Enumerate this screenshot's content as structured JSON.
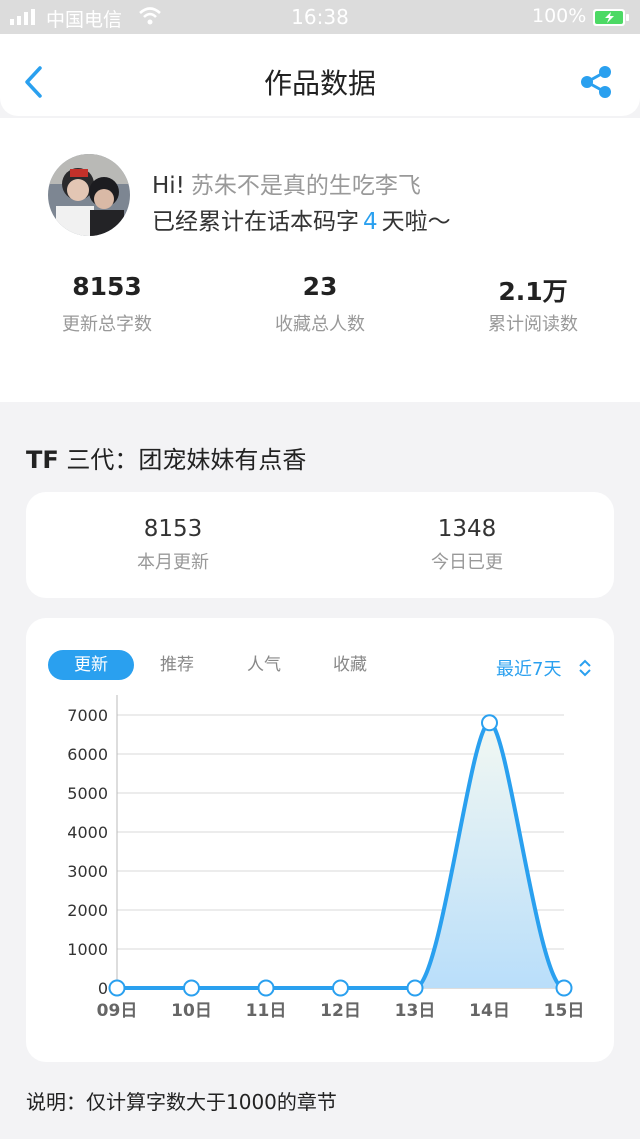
{
  "status_bar": {
    "carrier": "中国电信",
    "time": "16:38",
    "battery": "100%"
  },
  "nav": {
    "title": "作品数据",
    "icons": {
      "back": "back-chevron-icon",
      "share": "share-icon"
    }
  },
  "profile": {
    "greeting": "Hi!",
    "username": "苏朱不是真的生吃李飞",
    "line_prefix": "已经累计在话本码字",
    "days": "4",
    "line_suffix": "天啦～",
    "stats": [
      {
        "value": "8153",
        "label": "更新总字数"
      },
      {
        "value": "23",
        "label": "收藏总人数"
      },
      {
        "value": "2.1万",
        "label": "累计阅读数"
      }
    ]
  },
  "book": {
    "title_prefix": "TF",
    "title_rest": " 三代：团宠妹妹有点香"
  },
  "summary": [
    {
      "value": "8153",
      "label": "本月更新"
    },
    {
      "value": "1348",
      "label": "今日已更"
    }
  ],
  "chart_card": {
    "tabs": [
      "更新",
      "推荐",
      "人气",
      "收藏"
    ],
    "active_tab": 0,
    "range_label": "最近7天"
  },
  "chart_data": {
    "type": "area",
    "x": [
      "09日",
      "10日",
      "11日",
      "12日",
      "13日",
      "14日",
      "15日"
    ],
    "series": [
      {
        "values": [
          0,
          0,
          0,
          0,
          0,
          6800,
          0
        ]
      }
    ],
    "ylim": [
      0,
      7000
    ],
    "yticks": [
      0,
      1000,
      2000,
      3000,
      4000,
      5000,
      6000,
      7000
    ],
    "grid": true,
    "colors": {
      "line": "#2aa0ef",
      "fill_top": "#f2f8f2",
      "fill_bottom": "#b9defa"
    }
  },
  "note": "说明：仅计算字数大于1000的章节"
}
